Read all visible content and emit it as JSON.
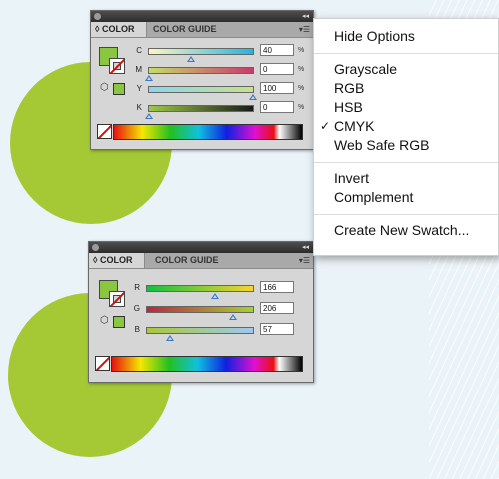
{
  "colors": {
    "fill": "#8ac640",
    "circle": "#a5c934",
    "menu_bg": "#ffffff",
    "panel_bg": "#d6d6d6"
  },
  "panel_top": {
    "tabs": [
      "◊ COLOR",
      "COLOR GUIDE"
    ],
    "mode": "CMYK",
    "channels": [
      {
        "label": "C",
        "value": "40",
        "unit": "%"
      },
      {
        "label": "M",
        "value": "0",
        "unit": "%"
      },
      {
        "label": "Y",
        "value": "100",
        "unit": "%"
      },
      {
        "label": "K",
        "value": "0",
        "unit": "%"
      }
    ]
  },
  "panel_bottom": {
    "tabs": [
      "◊ COLOR",
      "COLOR GUIDE"
    ],
    "mode": "RGB",
    "channels": [
      {
        "label": "R",
        "value": "166"
      },
      {
        "label": "G",
        "value": "206"
      },
      {
        "label": "B",
        "value": "57"
      }
    ]
  },
  "menu": {
    "items": [
      "Hide Options",
      "Grayscale",
      "RGB",
      "HSB",
      "CMYK",
      "Web Safe RGB",
      "Invert",
      "Complement",
      "Create New Swatch..."
    ],
    "checked": "CMYK",
    "check_glyph": "✓"
  }
}
